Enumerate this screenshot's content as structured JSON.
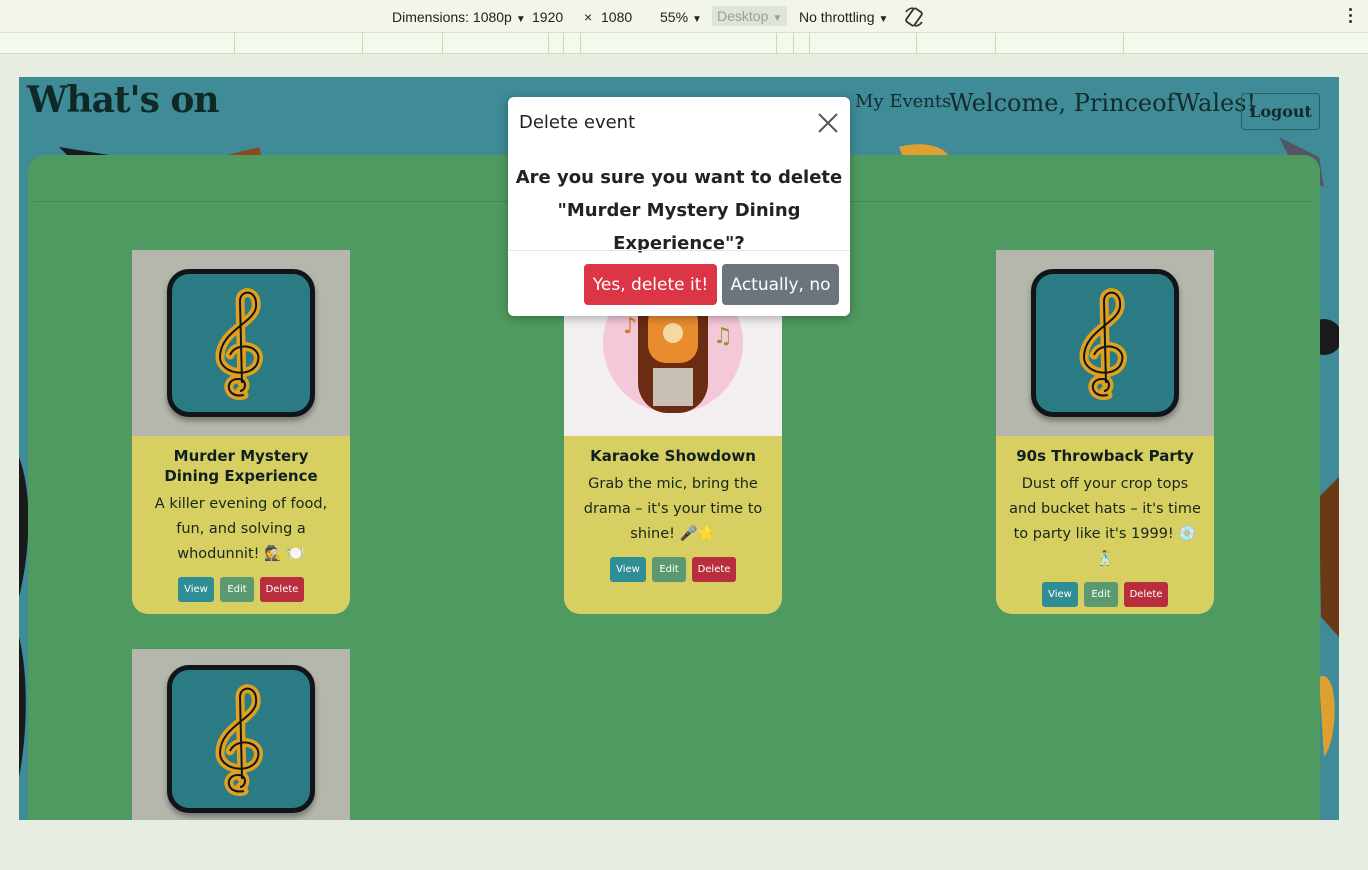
{
  "devtools": {
    "dimensions_label": "Dimensions: 1080p",
    "width": "1920",
    "times": "×",
    "height": "1080",
    "zoom": "55%",
    "device": "Desktop",
    "throttling": "No throttling"
  },
  "site": {
    "title": "What's on",
    "nav_my_events": "My Events",
    "welcome": "Welcome, PrinceofWales!",
    "logout": "Logout"
  },
  "events": [
    {
      "title": "Murder Mystery Dining Experience",
      "description": "A killer evening of food, fun, and solving a whodunnit! 🕵️ 🍽️",
      "image": "treble-clef-icon"
    },
    {
      "title": "Karaoke Showdown",
      "description": "Grab the mic, bring the drama – it's your time to shine! 🎤🌟",
      "image": "jukebox-image"
    },
    {
      "title": "90s Throwback Party",
      "description": "Dust off your crop tops and bucket hats – it's time to party like it's 1999! 💿 🕺",
      "image": "treble-clef-icon"
    },
    {
      "title": "",
      "description": "",
      "image": "treble-clef-icon"
    }
  ],
  "card_buttons": {
    "view": "View",
    "edit": "Edit",
    "delete": "Delete"
  },
  "modal": {
    "title": "Delete event",
    "question": "Are you sure you want to delete",
    "event_name": "\"Murder Mystery Dining Experience\"?",
    "confirm": "Yes, delete it!",
    "cancel": "Actually, no"
  },
  "colors": {
    "panel": "#4f9a60",
    "card": "#d8cf62",
    "danger": "#dc3545",
    "secondary": "#6c757d"
  }
}
